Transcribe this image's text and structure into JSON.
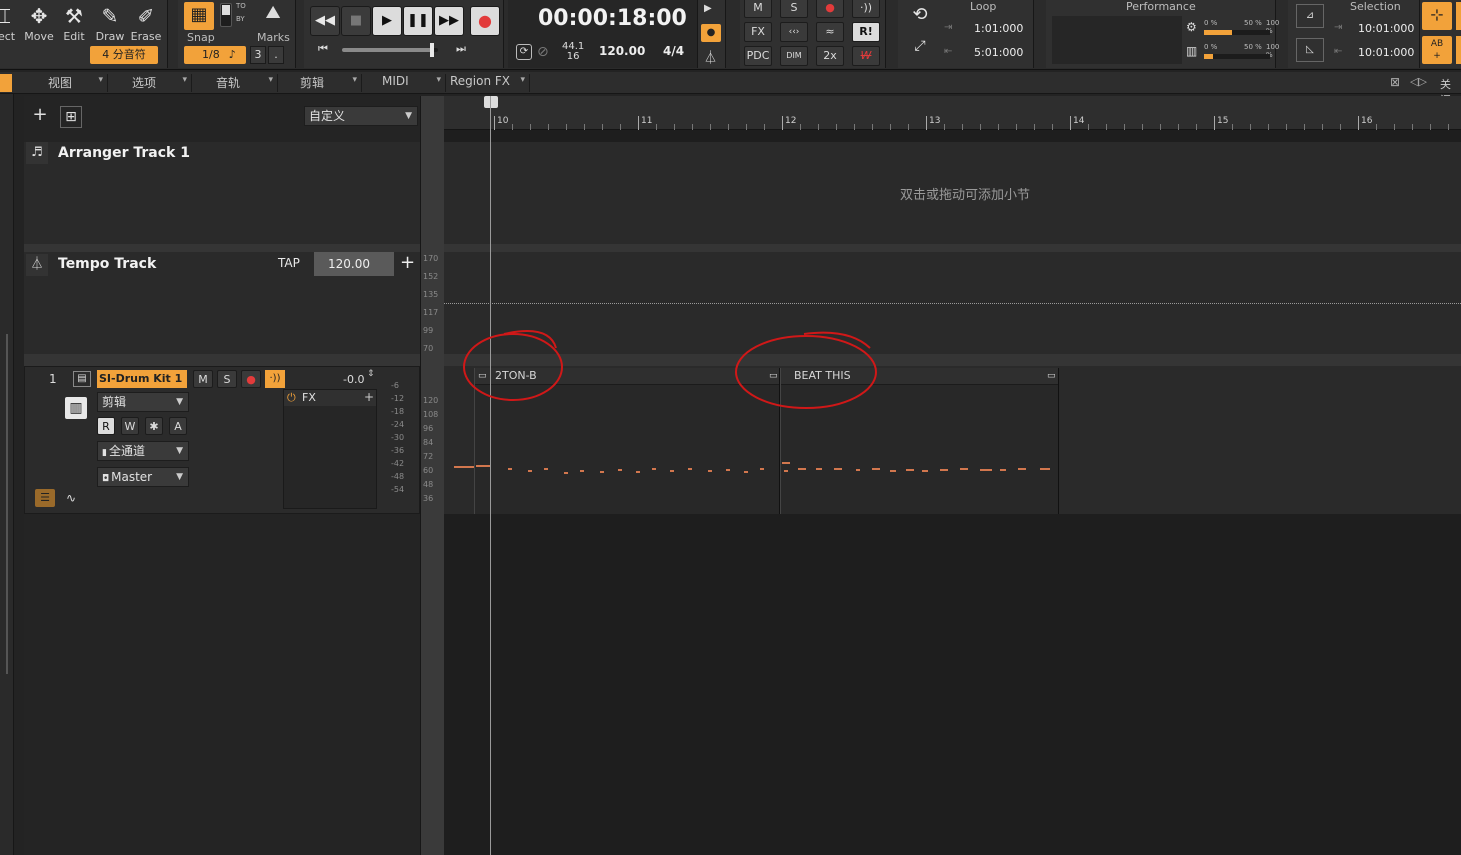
{
  "tools": {
    "select_label": "lect",
    "move_label": "Move",
    "edit_label": "Edit",
    "draw_label": "Draw",
    "erase_label": "Erase",
    "note_value": "4 分音符",
    "snap_label": "Snap",
    "snap_value": "1/8",
    "snap_note_glyph": "♪",
    "snap_count": "3",
    "snap_dot": ".",
    "to_label": "TO",
    "by_label": "BY",
    "marks_label": "Marks"
  },
  "transport": {
    "time": "00:00:18:00",
    "sample_rate_top": "44.1",
    "sample_rate_bottom": "16",
    "tempo": "120.00",
    "meter": "4/4"
  },
  "mix_buttons": {
    "m": "M",
    "s": "S",
    "fx": "FX",
    "pdc": "PDC",
    "dim": "DIM",
    "x2": "2x",
    "r": "R!",
    "w": "W"
  },
  "loop": {
    "title": "Loop",
    "start": "1:01:000",
    "end": "5:01:000"
  },
  "performance": {
    "title": "Performance",
    "meter1_left": "0 %",
    "meter1_mid": "50 %",
    "meter1_right": "100 %",
    "meter1_level": 0.42,
    "meter2_left": "0 %",
    "meter2_mid": "50 %",
    "meter2_right": "100 %",
    "meter2_level": 0.14
  },
  "selection": {
    "title": "Selection",
    "start": "10:01:000",
    "end": "10:01:000",
    "ab_label": "AB"
  },
  "menubar": {
    "view": "视图",
    "options": "选项",
    "track": "音轨",
    "clip": "剪辑",
    "midi": "MIDI",
    "region_fx": "Region FX",
    "close_label": "关闭"
  },
  "track_pane": {
    "preset": "自定义",
    "arranger_title": "Arranger Track 1",
    "tempo_title": "Tempo Track",
    "tap_label": "TAP",
    "tempo_value": "120.00"
  },
  "drum_track": {
    "number": "1",
    "name": "SI-Drum Kit 1",
    "m_label": "M",
    "s_label": "S",
    "volume": "-0.0",
    "edit_mode": "剪辑",
    "fx_label": "FX",
    "r_label": "R",
    "w_label": "W",
    "star_label": "✱",
    "a_label": "A",
    "channel": "全通道",
    "output": "Master",
    "meter_ticks": [
      "-6",
      "-12",
      "-18",
      "-24",
      "-30",
      "-36",
      "-42",
      "-48",
      "-54"
    ]
  },
  "tempo_ruler_ticks": [
    "170",
    "152",
    "135",
    "117",
    "99",
    "70"
  ],
  "velocity_ruler_ticks": [
    "120",
    "108",
    "96",
    "84",
    "72",
    "60",
    "48",
    "36"
  ],
  "ruler_bars": [
    "10",
    "11",
    "12",
    "13",
    "14",
    "15",
    "16"
  ],
  "arranger_hint": "双击或拖动可添加小节",
  "clips": [
    {
      "name": "2TON-B"
    },
    {
      "name": "BEAT THIS"
    }
  ],
  "colors": {
    "accent": "#f2a23a",
    "record": "#e23b3b",
    "annotation": "#d01818",
    "midi_note": "#d2774e"
  }
}
